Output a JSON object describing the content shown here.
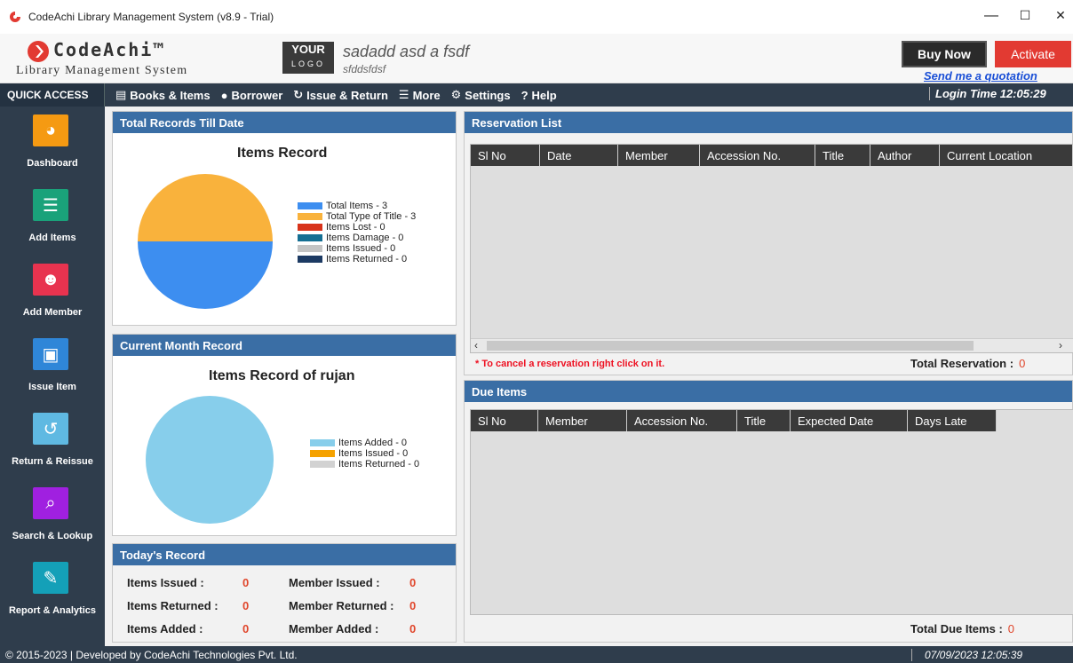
{
  "window": {
    "title": "CodeAchi Library Management System (v8.9 - Trial)",
    "controls": {
      "minimize": "—",
      "maximize": "☐",
      "close": "✕"
    }
  },
  "header": {
    "brand": "CodeAchi™",
    "subtitle": "Library Management System",
    "your_logo_top": "YOUR",
    "your_logo_bottom": "LOGO",
    "org_name": "sadadd asd a fsdf",
    "org_sub": "sfddsfdsf",
    "buy_now": "Buy Now",
    "activate": "Activate",
    "quotation": "Send me a quotation"
  },
  "menubar": {
    "quick_access": "QUICK ACCESS",
    "items": [
      {
        "label": "Books & Items",
        "icon": "book-icon"
      },
      {
        "label": "Borrower",
        "icon": "user-icon"
      },
      {
        "label": "Issue & Return",
        "icon": "issue-return-icon"
      },
      {
        "label": "More",
        "icon": "menu-icon"
      },
      {
        "label": "Settings",
        "icon": "gear-icon"
      },
      {
        "label": "Help",
        "icon": "help-icon"
      }
    ],
    "login_time": "Login Time 12:05:29"
  },
  "sidebar": {
    "items": [
      {
        "label": "Dashboard",
        "icon": "pie-chart-icon",
        "color": "#f59a12"
      },
      {
        "label": "Add Items",
        "icon": "book-stack-icon",
        "color": "#1aa27a"
      },
      {
        "label": "Add Member",
        "icon": "user-add-icon",
        "color": "#e8334f"
      },
      {
        "label": "Issue Item",
        "icon": "issue-book-icon",
        "color": "#2f86d8"
      },
      {
        "label": "Return & Reissue",
        "icon": "return-icon",
        "color": "#5fb9e2"
      },
      {
        "label": "Search & Lookup",
        "icon": "search-icon",
        "color": "#a020e0"
      },
      {
        "label": "Report & Analytics",
        "icon": "report-icon",
        "color": "#14a0b8"
      }
    ]
  },
  "total_records": {
    "panel_title": "Total Records Till Date",
    "chart_title": "Items Record",
    "legend": [
      {
        "label": "Total Items - 3",
        "color": "#3d8ef0"
      },
      {
        "label": "Total Type of Title - 3",
        "color": "#f9b23c"
      },
      {
        "label": "Items Lost - 0",
        "color": "#d8331a"
      },
      {
        "label": "Items Damage - 0",
        "color": "#156f93"
      },
      {
        "label": "Items Issued - 0",
        "color": "#c4c4c4"
      },
      {
        "label": "Items Returned - 0",
        "color": "#1c3a63"
      }
    ]
  },
  "current_month": {
    "panel_title": "Current Month Record",
    "chart_title": "Items Record of rujan",
    "legend": [
      {
        "label": "Items Added - 0",
        "color": "#87ceeb"
      },
      {
        "label": "Items Issued - 0",
        "color": "#f5a200"
      },
      {
        "label": "Items Returned - 0",
        "color": "#d2d2d2"
      }
    ]
  },
  "chart_data": [
    {
      "type": "pie",
      "title": "Items Record",
      "categories": [
        "Total Items",
        "Total Type of Title",
        "Items Lost",
        "Items Damage",
        "Items Issued",
        "Items Returned"
      ],
      "values": [
        3,
        3,
        0,
        0,
        0,
        0
      ],
      "legend": "right"
    },
    {
      "type": "pie",
      "title": "Items Record of rujan",
      "categories": [
        "Items Added",
        "Items Issued",
        "Items Returned"
      ],
      "values": [
        0,
        0,
        0
      ],
      "legend": "right"
    }
  ],
  "todays_record": {
    "panel_title": "Today's Record",
    "items_issued": "Items Issued :",
    "items_issued_val": "0",
    "items_returned": "Items Returned :",
    "items_returned_val": "0",
    "items_added": "Items Added :",
    "items_added_val": "0",
    "member_issued": "Member Issued :",
    "member_issued_val": "0",
    "member_returned": "Member Returned :",
    "member_returned_val": "0",
    "member_added": "Member Added :",
    "member_added_val": "0"
  },
  "reservation": {
    "panel_title": "Reservation List",
    "columns": [
      "Sl No",
      "Date",
      "Member",
      "Accession No.",
      "Title",
      "Author",
      "Current Location"
    ],
    "note": "* To cancel a reservation right click on it.",
    "total_label": "Total Reservation :",
    "total_value": "0"
  },
  "due_items": {
    "panel_title": "Due Items",
    "columns": [
      "Sl No",
      "Member",
      "Accession No.",
      "Title",
      "Expected Date",
      "Days Late"
    ],
    "total_label": "Total Due Items :",
    "total_value": "0"
  },
  "footer": {
    "copyright": "© 2015-2023 | Developed by CodeAchi Technologies Pvt. Ltd.",
    "datetime": "07/09/2023 12:05:39"
  }
}
